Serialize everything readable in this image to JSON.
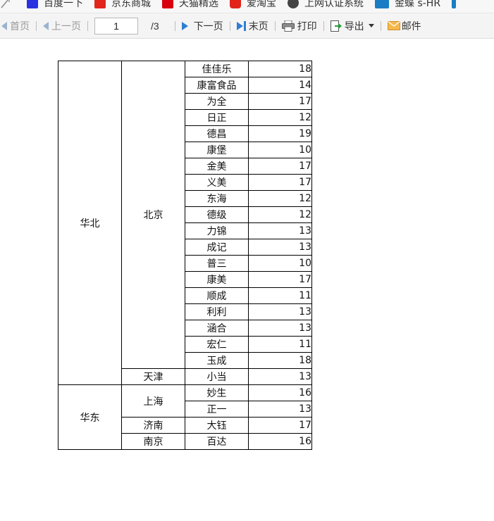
{
  "bookmarks": [
    {
      "icon": "bookmark-slash-icon",
      "label": ""
    },
    {
      "icon": "baidu-icon",
      "label": "百度一下"
    },
    {
      "icon": "jd-icon",
      "label": "京东商城"
    },
    {
      "icon": "tmall-icon",
      "label": "天猫精选"
    },
    {
      "icon": "taobao-icon",
      "label": "爱淘宝"
    },
    {
      "icon": "network-icon",
      "label": "上网认证系统"
    },
    {
      "icon": "stock-icon",
      "label": "金蝶 s-HR"
    }
  ],
  "toolbar": {
    "first_label": "首页",
    "prev_label": "上一页",
    "page_value": "1",
    "page_total": "/3",
    "next_label": "下一页",
    "last_label": "末页",
    "print_label": "打印",
    "export_label": "导出",
    "mail_label": "邮件"
  },
  "report": {
    "regions": [
      {
        "name": "华北",
        "cities": [
          {
            "name": "北京",
            "rows": [
              {
                "name": "佳佳乐",
                "value": "18"
              },
              {
                "name": "康富食品",
                "value": "14"
              },
              {
                "name": "为全",
                "value": "17"
              },
              {
                "name": "日正",
                "value": "12"
              },
              {
                "name": "德昌",
                "value": "19"
              },
              {
                "name": "康堡",
                "value": "10"
              },
              {
                "name": "金美",
                "value": "17"
              },
              {
                "name": "义美",
                "value": "17"
              },
              {
                "name": "东海",
                "value": "12"
              },
              {
                "name": "德级",
                "value": "12"
              },
              {
                "name": "力锦",
                "value": "13"
              },
              {
                "name": "成记",
                "value": "13"
              },
              {
                "name": "普三",
                "value": "10"
              },
              {
                "name": "康美",
                "value": "17"
              },
              {
                "name": "顺成",
                "value": "11"
              },
              {
                "name": "利利",
                "value": "13"
              },
              {
                "name": "涵合",
                "value": "13"
              },
              {
                "name": "宏仁",
                "value": "11"
              },
              {
                "name": "玉成",
                "value": "18"
              }
            ]
          },
          {
            "name": "天津",
            "rows": [
              {
                "name": "小当",
                "value": "13"
              }
            ]
          }
        ]
      },
      {
        "name": "华东",
        "cities": [
          {
            "name": "上海",
            "rows": [
              {
                "name": "妙生",
                "value": "16"
              },
              {
                "name": "正一",
                "value": "13"
              }
            ]
          },
          {
            "name": "济南",
            "rows": [
              {
                "name": "大钰",
                "value": "17"
              }
            ]
          },
          {
            "name": "南京",
            "rows": [
              {
                "name": "百达",
                "value": "16"
              }
            ]
          }
        ]
      }
    ]
  }
}
